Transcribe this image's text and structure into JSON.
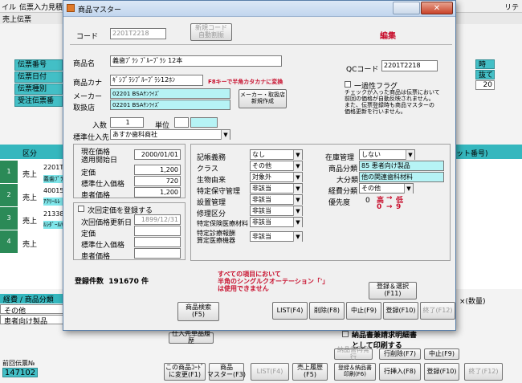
{
  "background": {
    "menu": [
      "イル",
      "伝票入力",
      "見積"
    ],
    "menu_right": "リティ",
    "window_title": "売上伝票",
    "left_labels": [
      "伝票番号",
      "伝票日付",
      "伝票種別",
      "受注伝票番"
    ],
    "right_top_values": [
      "時",
      "抜て",
      "20"
    ],
    "grid_header_left": "区分",
    "grid_header_right": "ット番号)",
    "row_numbers": [
      "1",
      "2",
      "3",
      "4"
    ],
    "row_types": [
      "売上",
      "売上",
      "売上",
      "売上"
    ],
    "row_codes": [
      "2201T",
      "40015",
      "21338",
      ""
    ],
    "row_names": [
      "義歯ﾌﾟﾗｼ",
      "ｱｸﾘｰﾙﾚ",
      "ﾙｼﾀﾞｰﾙﾊﾞ"
    ],
    "bottom_rows": [
      "経費 / 商品分類",
      "その他",
      "患者向け製品"
    ],
    "tax_label": "×(数量)",
    "prev_slip_label": "前回伝票№",
    "prev_slip_value": "147102",
    "supplier_history_btn": "仕入先単品履歴",
    "print_specs_check": "納品書兼請求明細書\nとして印刷する",
    "buttons": [
      "この商品ｺｰﾄﾞ\nに変更(F1)",
      "商品\nマスター(F3)",
      "LIST(F4)",
      "売上履歴\n(F5)",
      "登録＆納品書\n印刷(F6)",
      "行挿入(F8)",
      "登録(F10)",
      "終了(F12)"
    ],
    "buttons_row2": [
      "納品書再発行",
      "行削除(F7)",
      "中止(F9)"
    ]
  },
  "dialog": {
    "title": "商品マスター",
    "code_label": "コード",
    "code_value": "2201T2218",
    "new_code_btn": "新規コード\n自動割振",
    "mode": "編集",
    "product_name_label": "商品名",
    "product_name": "義歯ﾌﾞﾗｼ ﾌﾞﾙｰﾌﾞﾗｼ 12本",
    "kana_label": "商品カナ",
    "kana_value": "ｷﾞｼﾌﾞﾗｼﾌﾞﾙｰﾌﾞﾗｼ12ﾎﾝ",
    "kana_note": "F8キーで半角カタカナに変換",
    "maker_label": "メーカー",
    "maker_code": "02201",
    "maker_name": "BSAｻﾝﾗｲｽﾞ",
    "dealer_label": "取扱店",
    "dealer_code": "02201",
    "dealer_name": "BSAｻﾝﾗｲｽﾞ",
    "maker_new_btn": "メーカー・取扱店\n新規作成",
    "qc_label": "QCコード",
    "qc_value": "2201T2218",
    "batch_flag": "一過性フラグ",
    "batch_note": "チェックが入った商品は伝票において\n前回の価格が自動反映されません。\nまた、伝票登録時も商品マスターの\n価格更新を行いません。",
    "qty_label": "入数",
    "qty_value": "1",
    "unit_label": "単位",
    "supplier_label": "標準仕入先",
    "supplier_value": "あすか歯科商社",
    "current_price_label": "現在価格\n適用開始日",
    "current_date": "2000/01/01",
    "list_price_label": "定価",
    "list_price": "1,200",
    "std_cost_label": "標準仕入価格",
    "std_cost": "720",
    "patient_price_label": "患者価格",
    "patient_price": "1,200",
    "next_price_check": "次回定価を登録する",
    "next_date_label": "次回価格更新日",
    "next_date": "1899/12/31",
    "next_list_label": "定価",
    "next_cost_label": "標準仕入価格",
    "next_patient_label": "患者価格",
    "right_fields": [
      {
        "label": "記帳義務",
        "value": "なし"
      },
      {
        "label": "クラス",
        "value": "その他"
      },
      {
        "label": "生物由来",
        "value": "対象外"
      },
      {
        "label": "特定保守管理",
        "value": "非該当"
      },
      {
        "label": "設置管理",
        "value": "非該当"
      },
      {
        "label": "修理区分",
        "value": "非該当"
      },
      {
        "label": "特定保険医療材料",
        "value": "非該当"
      },
      {
        "label": "特定診療報酬\n算定医療機器",
        "value": "非該当"
      }
    ],
    "stock_label": "在庫管理",
    "stock_value": "しない",
    "cat_label": "商品分類",
    "cat_value": "85 患者向け製品",
    "major_label": "大分類",
    "major_value": "他の関連歯科材料",
    "expense_label": "経費分類",
    "expense_value": "その他",
    "priority_label": "優先度",
    "priority_value": "0",
    "priority_high": "高",
    "priority_low": "低",
    "priority_range_lo": "0",
    "priority_range_hi": "9",
    "count_label": "登録件数",
    "count_value": "191670",
    "count_unit": "件",
    "warning": "すべての項目において\n半角のシングルクオーテーション「'」\nは使用できません",
    "register_select_btn": "登録＆選択\n(F11)",
    "btn_product_search": "商品検索\n(F5)",
    "btn_list": "LIST(F4)",
    "btn_delete": "削除(F8)",
    "btn_cancel": "中止(F9)",
    "btn_register": "登録(F10)",
    "btn_exit": "終了(F12)"
  },
  "colors": {
    "teal": "#43bfc6",
    "red": "#c8102e",
    "cyan_field": "#b6f3f5"
  }
}
